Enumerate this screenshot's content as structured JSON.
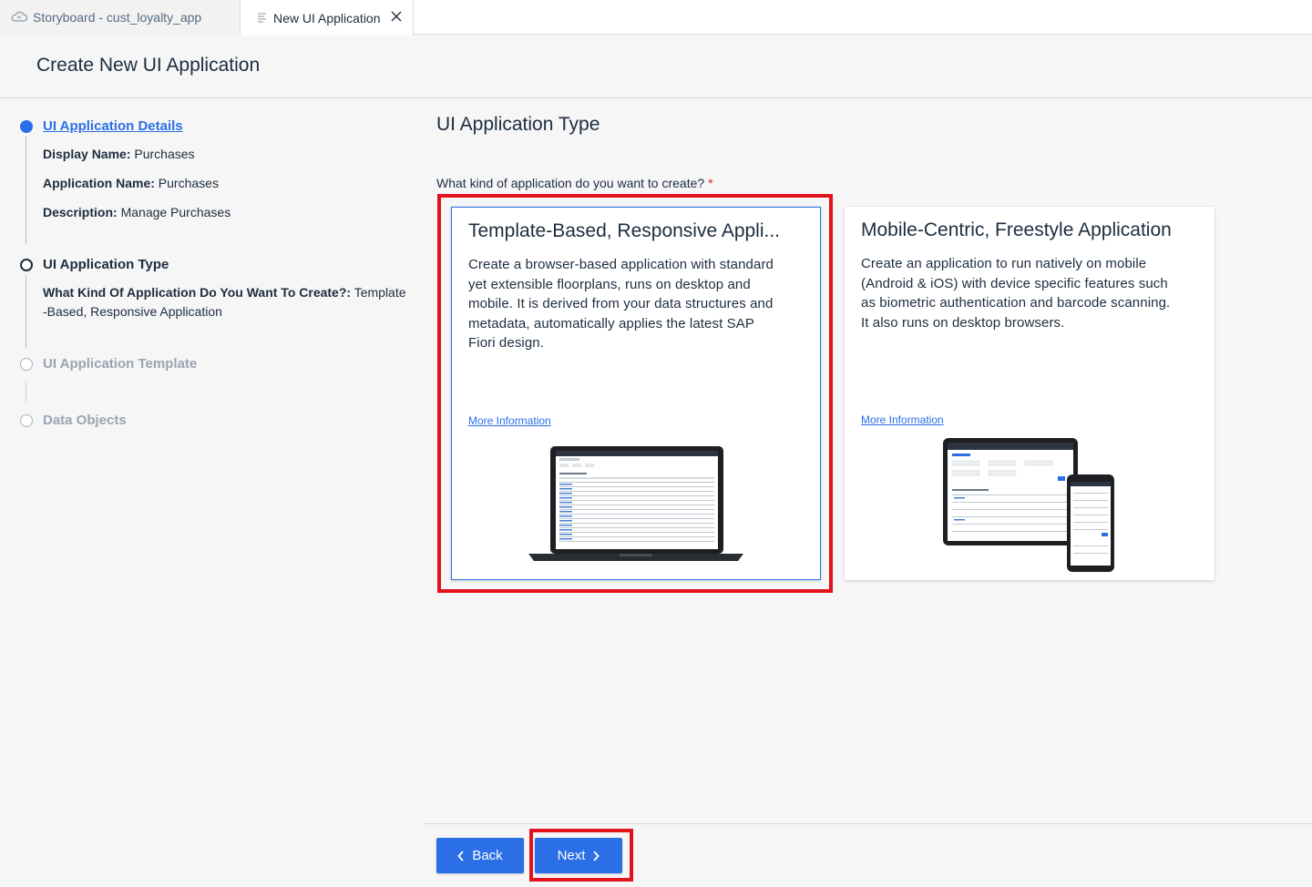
{
  "tabs": [
    {
      "label": "Storyboard - cust_loyalty_app",
      "icon": "cloud-icon"
    },
    {
      "label": "New UI Application",
      "icon": "document-icon",
      "close_icon": "close-icon"
    }
  ],
  "page": {
    "title": "Create New UI Application"
  },
  "steps": [
    {
      "title": "UI Application Details",
      "details": [
        {
          "label": "Display Name:",
          "value": "Purchases"
        },
        {
          "label": "Application Name:",
          "value": "Purchases"
        },
        {
          "label": "Description:",
          "value": "Manage Purchases"
        }
      ]
    },
    {
      "title": "UI Application Type",
      "details": [
        {
          "label": "What Kind Of Application Do You Want To Create?:",
          "value_line1": "Template",
          "value_line2": "-Based, Responsive Application"
        }
      ]
    },
    {
      "title": "UI Application Template"
    },
    {
      "title": "Data Objects"
    }
  ],
  "main": {
    "section_title": "UI Application Type",
    "question": "What kind of application do you want to create?",
    "required_marker": "*",
    "cards": [
      {
        "title": "Template-Based, Responsive Appli...",
        "description": [
          "Create a browser-based application with standard",
          "yet extensible floorplans, runs on desktop and",
          "mobile. It is derived from your data structures and",
          "metadata, automatically applies the latest SAP",
          "Fiori design."
        ],
        "link": "More Information",
        "selected": true,
        "illustration": "laptop-illustration"
      },
      {
        "title": "Mobile-Centric, Freestyle Application",
        "description": [
          "Create an application to run natively on mobile",
          "(Android & iOS) with device specific features such",
          "as biometric authentication and barcode scanning.",
          "It also runs on desktop browsers."
        ],
        "link": "More Information",
        "selected": false,
        "illustration": "tablet-phone-illustration"
      }
    ]
  },
  "footer": {
    "back_label": "Back",
    "next_label": "Next"
  },
  "colors": {
    "accent": "#2a6fe6",
    "highlight": "#e2121a",
    "text": "#1d2d3e",
    "dim": "#99a5b0"
  }
}
